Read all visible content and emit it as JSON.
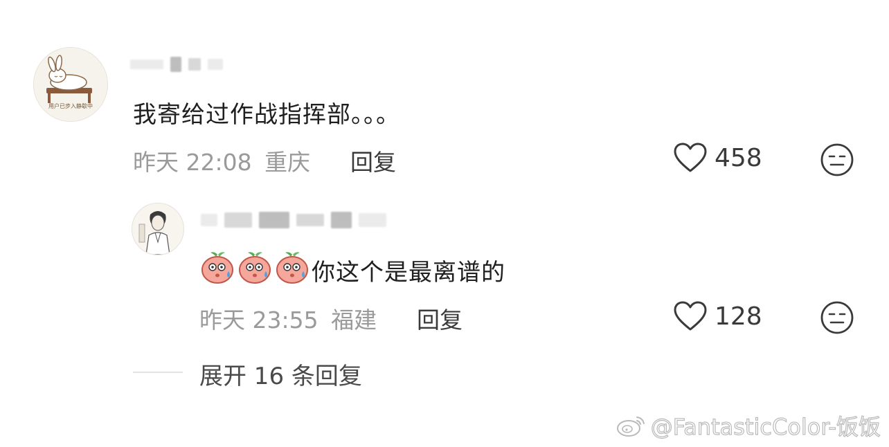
{
  "comments": [
    {
      "avatar_caption": "用户已步入静歇中",
      "text": "我寄给过作战指挥部。。。",
      "time": "昨天 22:08",
      "location": "重庆",
      "reply_label": "回复",
      "likes": "458",
      "icon": "neutral-face-icon"
    },
    {
      "text": "你这个是最离谱的",
      "emojis": [
        "sweating-peach-emoji",
        "sweating-peach-emoji",
        "sweating-peach-emoji"
      ],
      "time": "昨天 23:55",
      "location": "福建",
      "reply_label": "回复",
      "likes": "128",
      "icon": "neutral-face-icon"
    }
  ],
  "expand_replies": "展开 16 条回复",
  "watermark": "@FantasticColor-饭饭",
  "colors": {
    "text_primary": "#1f1f1f",
    "text_meta": "#9a9a9a",
    "text_action": "#3a3a3a"
  }
}
